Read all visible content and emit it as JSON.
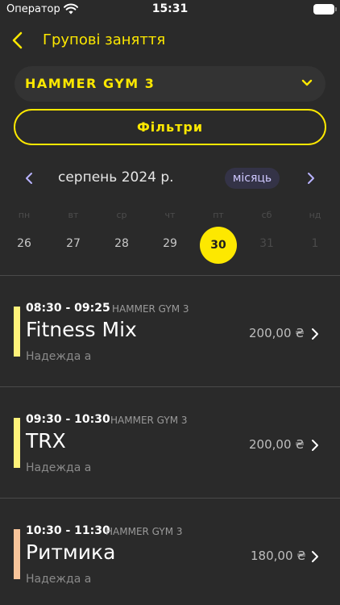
{
  "status_bar": {
    "carrier": "Оператор",
    "time": "15:31",
    "icons": [
      "wifi-icon",
      "battery-icon"
    ]
  },
  "header": {
    "title": "Групові заняття",
    "back_icon": "chevron-left-icon"
  },
  "gym_select": {
    "value": "HAMMER GYM 3",
    "icon": "chevron-down-icon"
  },
  "filters": {
    "label": "Фільтри"
  },
  "calendar": {
    "month_label": "серпень 2024 р.",
    "view_toggle": "місяць",
    "weekdays": [
      "пн",
      "вт",
      "ср",
      "чт",
      "пт",
      "сб",
      "нд"
    ],
    "days": [
      "26",
      "27",
      "28",
      "29",
      "30",
      "31",
      "1"
    ],
    "selected_day": "30"
  },
  "sessions": [
    {
      "time": "08:30 - 09:25",
      "gym": "HAMMER GYM 3",
      "name": "Fitness Mix",
      "trainer": "Надежда а",
      "price": "200,00 ₴",
      "color": "#fff27a"
    },
    {
      "time": "09:30 - 10:30",
      "gym": "HAMMER GYM 3",
      "name": "TRX",
      "trainer": "Надежда а",
      "price": "200,00 ₴",
      "color": "#fff27a"
    },
    {
      "time": "10:30 - 11:30",
      "gym": "HAMMER GYM 3",
      "name": "Ритмика",
      "trainer": "Надежда а",
      "price": "180,00 ₴",
      "color": "#f7c49a"
    }
  ],
  "colors": {
    "accent": "#fde800",
    "background": "#2a2a2a",
    "card": "#333333"
  }
}
